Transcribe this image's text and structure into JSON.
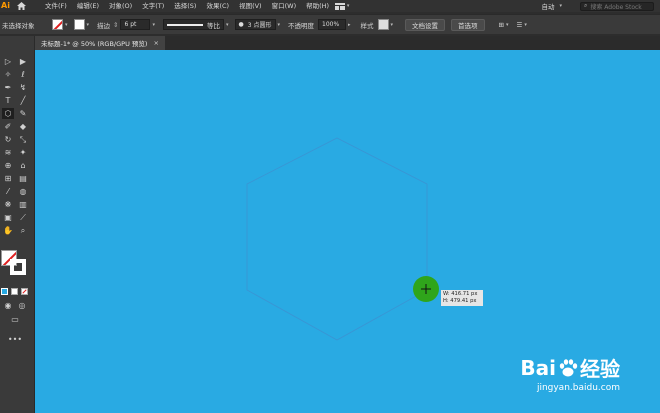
{
  "app": {
    "logo": "Ai"
  },
  "menu": [
    "文件(F)",
    "编辑(E)",
    "对象(O)",
    "文字(T)",
    "选择(S)",
    "效果(C)",
    "视图(V)",
    "窗口(W)",
    "帮助(H)"
  ],
  "topbar": {
    "workspace": "自动",
    "search_placeholder": "搜索 Adobe Stock"
  },
  "control": {
    "selection_label": "未选择对象",
    "stroke_label": "描边",
    "stroke_value": "6 pt",
    "profile_label": "等比",
    "brush_label": "3 点圆形",
    "opacity_label": "不透明度",
    "opacity_value": "100%",
    "style_label": "样式",
    "doc_setup_btn": "文档设置",
    "prefs_btn": "首选项"
  },
  "tab": {
    "title": "未标题-1* @ 50% (RGB/GPU 预览)",
    "close": "×"
  },
  "canvas": {
    "bg_color": "#29aae3",
    "tooltip_w": "W: 416.71 px",
    "tooltip_h": "H: 479.41 px"
  },
  "watermark": {
    "brand": "Bai",
    "brand2": "经验",
    "url": "jingyan.baidu.com"
  },
  "icons": [
    "home-icon",
    "workspace-icon",
    "search-icon",
    "crosshair-icon",
    "paw-icon"
  ]
}
